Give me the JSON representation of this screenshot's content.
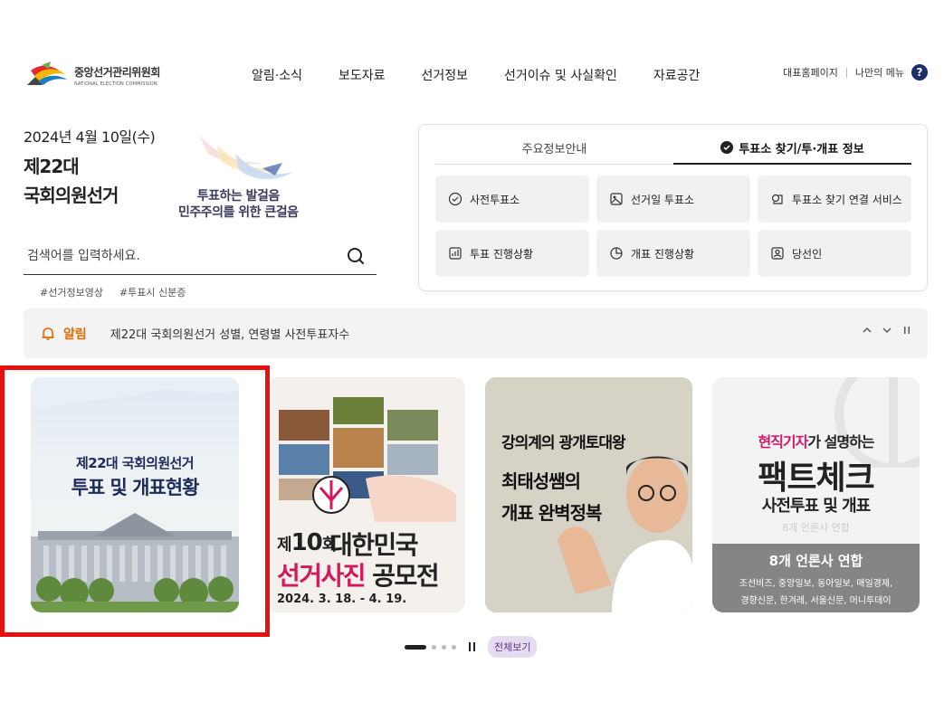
{
  "header": {
    "logo_ko": "중앙선거관리위원회",
    "logo_en": "NATIONAL ELECTION COMMISSION",
    "gnb": [
      "알림·소식",
      "보도자료",
      "선거정보",
      "선거이슈 및 사실확인",
      "자료공간"
    ],
    "util_home": "대표홈페이지",
    "util_menu": "나만의 메뉴",
    "help_symbol": "?"
  },
  "hero": {
    "date": "2024년 4월 10일(수)",
    "title_line1": "제22대",
    "title_line2": "국회의원선거",
    "slogan_line1": "투표하는 발걸음",
    "slogan_line2": "민주주의를 위한 큰걸음"
  },
  "search": {
    "placeholder": "검색어를 입력하세요.",
    "tags": [
      "#선거정보영상",
      "#투표시 신분증"
    ]
  },
  "panel": {
    "tabs": [
      "주요정보안내",
      "투표소 찾기/투·개표 정보"
    ],
    "active_tab": 1,
    "cards": [
      "사전투표소",
      "선거일 투표소",
      "투표소 찾기 연결 서비스",
      "투표 진행상황",
      "개표 진행상황",
      "당선인"
    ]
  },
  "alert": {
    "label": "알림",
    "text": "제22대 국회의원선거 성별, 연령별 사전투표자수",
    "accent_color": "#e66a00"
  },
  "banners": {
    "b1": {
      "line1": "제22대 국회의원선거",
      "line2": "투표 및 개표현황"
    },
    "b2": {
      "ordinal_pre": "제",
      "ordinal_num": "10",
      "ordinal_post": "회",
      "title1": "대한민국",
      "title2a": "선거사진",
      "title2b": "공모전",
      "date": "2024. 3. 18. - 4. 19."
    },
    "b3": {
      "line1": "강의계의 광개토대왕",
      "line2": "최태성쌤의",
      "line3": "개표 완벽정복"
    },
    "b4": {
      "line1a": "현직기자",
      "line1b": "가 설명하는",
      "line2": "팩트체크",
      "line3": "사전투표 및 개표",
      "line4": "8개 언론사 연합",
      "bottom1": "8개 언론사 연합",
      "bottom2": "조선비즈, 중앙일보, 동아일보, 매일경제,",
      "bottom3": "경향신문, 한겨레, 서울신문, 머니투데이"
    }
  },
  "pager": {
    "all_label": "전체보기"
  }
}
